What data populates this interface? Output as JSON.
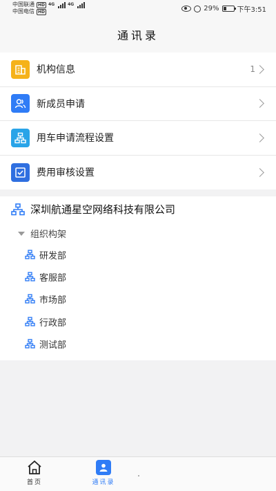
{
  "status_bar": {
    "carrier1": "中国联通",
    "carrier2": "中国电信",
    "hd": "HD",
    "net1": "4G",
    "net2": "4G",
    "battery_level": 0.29,
    "battery_text": "29%",
    "time": "下午3:51"
  },
  "header": {
    "title": "通讯录"
  },
  "menu": {
    "items": [
      {
        "label": "机构信息",
        "count": "1",
        "icon": "building-icon",
        "color": "#f5b21a"
      },
      {
        "label": "新成员申请",
        "icon": "users-icon",
        "color": "#2f7cf6"
      },
      {
        "label": "用车申请流程设置",
        "icon": "org-chart-icon",
        "color": "#29a4e8"
      },
      {
        "label": "费用审核设置",
        "icon": "checkbox-icon",
        "color": "#2f6fe0"
      }
    ]
  },
  "org": {
    "company": "深圳航通星空网络科技有限公司",
    "root": "组织构架",
    "departments": [
      "研发部",
      "客服部",
      "市场部",
      "行政部",
      "测试部"
    ]
  },
  "tabbar": {
    "tabs": [
      {
        "label": "首页",
        "icon": "home-icon"
      },
      {
        "label": "通讯录",
        "icon": "contacts-icon",
        "active": true
      }
    ],
    "accent": "#2f7cf6"
  }
}
